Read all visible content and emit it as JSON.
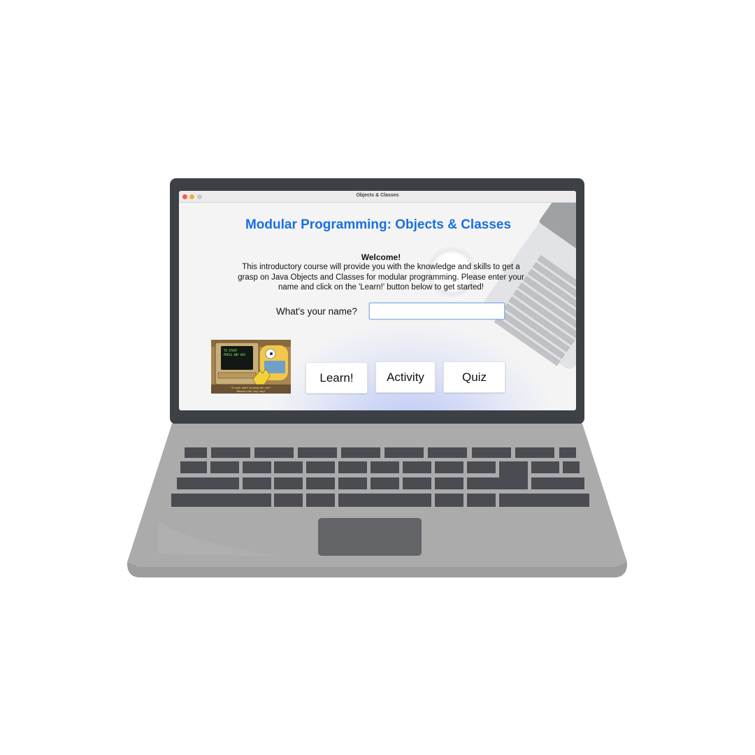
{
  "window": {
    "title": "Objects & Classes"
  },
  "main": {
    "heading": "Modular Programming: Objects & Classes",
    "welcome": "Welcome!",
    "intro_lines": [
      "This introductory course will provide you with the knowledge and skills to get a",
      "grasp on Java Objects and Classes for modular programming. Please enter your",
      "name and click on the 'Learn!' button below to get started!"
    ],
    "name_label": "What's your name?",
    "name_value": "",
    "name_placeholder": ""
  },
  "meme": {
    "screen_text": "TO START\nPRESS ANY KEY",
    "caption_line1": "\"It says 'start' so what do I do?\"",
    "caption_line2": "Where's the 'Any' key?"
  },
  "buttons": {
    "learn": "Learn!",
    "activity": "Activity",
    "quiz": "Quiz"
  },
  "colors": {
    "heading": "#1a6fde",
    "laptop_lid": "#3d4045",
    "laptop_body": "#ababab",
    "keys": "#4a4c51",
    "glow": "#b4c3f5"
  },
  "icons": {
    "window_controls": [
      "close-dot",
      "minimize-dot",
      "zoom-dot"
    ]
  }
}
